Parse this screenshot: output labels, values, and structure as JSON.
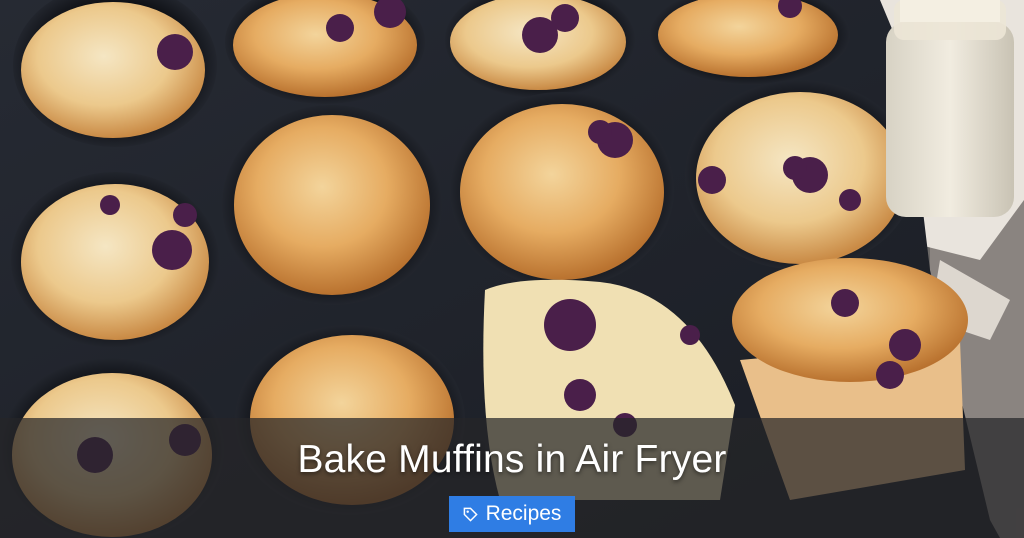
{
  "post": {
    "title": "Bake Muffins in Air Fryer",
    "category": {
      "label": "Recipes",
      "icon": "tag-icon",
      "color": "#2f7de4"
    }
  },
  "image": {
    "subject": "blueberry-muffins-in-tin-photo",
    "colors": {
      "tin": "#1e2128",
      "muffin": "#e6a864",
      "blueberry": "#4a1f4a",
      "overlay": "#262628"
    }
  }
}
